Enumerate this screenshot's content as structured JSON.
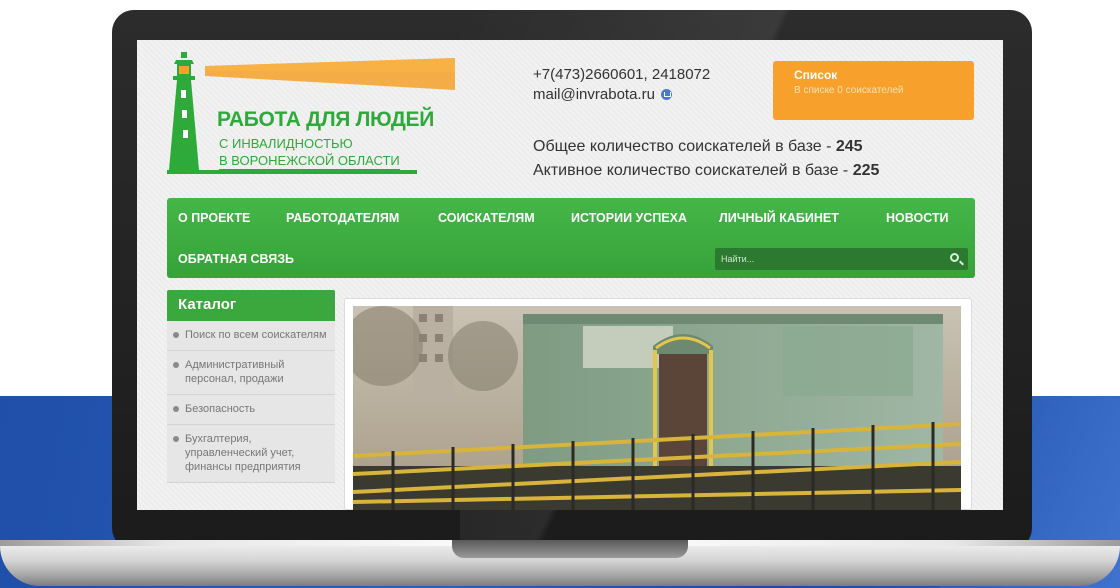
{
  "logo": {
    "title": "РАБОТА ДЛЯ ЛЮДЕЙ",
    "subtitle_line1": "С ИНВАЛИДНОСТЬЮ",
    "subtitle_line2": "В ВОРОНЕЖСКОЙ ОБЛАСТИ",
    "icon": "lighthouse-icon"
  },
  "contacts": {
    "phone": "+7(473)2660601, 2418072",
    "email": "mail@invrabota.ru"
  },
  "stats": {
    "total_label": "Общее количество соискателей в базе - ",
    "total_value": "245",
    "active_label": "Активное количество соискателей в базе - ",
    "active_value": "225"
  },
  "cart": {
    "title": "Список",
    "subtitle": "В списке 0 соискателей"
  },
  "nav": {
    "items": [
      {
        "label": "О ПРОЕКТЕ"
      },
      {
        "label": "РАБОТОДАТЕЛЯМ"
      },
      {
        "label": "СОИСКАТЕЛЯМ"
      },
      {
        "label": "ИСТОРИИ УСПЕХА"
      },
      {
        "label": "ЛИЧНЫЙ КАБИНЕТ"
      },
      {
        "label": "НОВОСТИ"
      },
      {
        "label": "ОБРАТНАЯ СВЯЗЬ"
      }
    ],
    "search_placeholder": "Найти..."
  },
  "catalog": {
    "title": "Каталог",
    "items": [
      {
        "label": "Поиск по всем соискателям"
      },
      {
        "label": "Административный персонал, продажи"
      },
      {
        "label": "Безопасность"
      },
      {
        "label": "Бухгалтерия, управленческий учет, финансы предприятия"
      }
    ]
  },
  "colors": {
    "brand_green": "#3aa83d",
    "cart_orange": "#f7a02b",
    "backdrop_blue": "#1f4fa8"
  }
}
